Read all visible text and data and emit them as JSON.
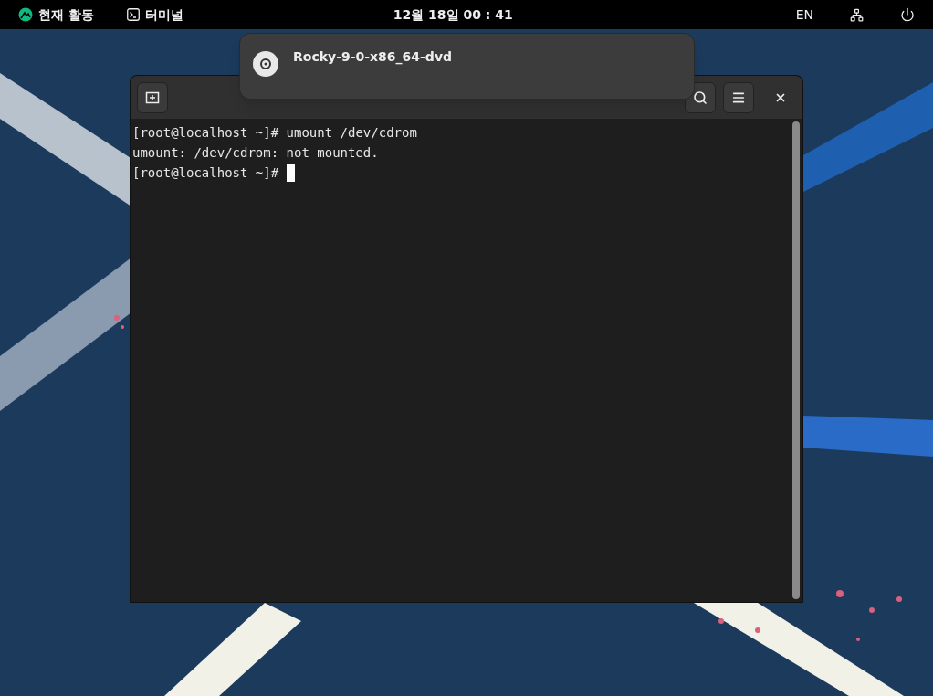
{
  "top_bar": {
    "activities": "현재 활동",
    "app_menu": "터미널",
    "clock": "12월 18일 00 : 41",
    "input_source": "EN"
  },
  "notification": {
    "title": "Rocky-9-0-x86_64-dvd"
  },
  "terminal": {
    "lines": [
      "[root@localhost ~]# umount /dev/cdrom",
      "umount: /dev/cdrom: not mounted.",
      "[root@localhost ~]# "
    ],
    "cursor_visible": true
  }
}
